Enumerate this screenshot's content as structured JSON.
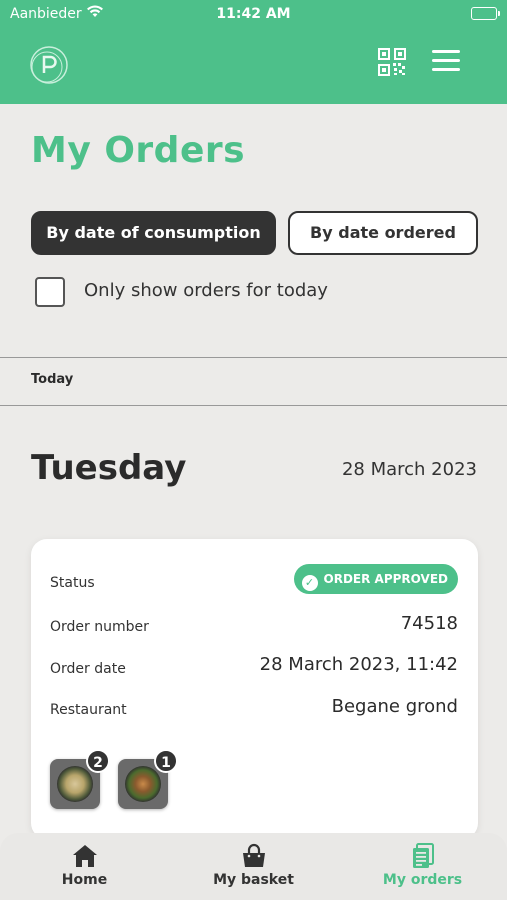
{
  "status_bar": {
    "carrier": "Aanbieder",
    "time": "11:42 AM"
  },
  "header": {
    "logo_icon": "p-logo-icon",
    "qr_icon": "qr-code-icon",
    "menu_icon": "hamburger-menu-icon"
  },
  "page": {
    "title": "My Orders"
  },
  "sort": {
    "by_consumption": "By date of consumption",
    "by_ordered": "By date ordered",
    "active": "by_consumption"
  },
  "filter": {
    "today_only_label": "Only show orders for today",
    "checked": false
  },
  "section": {
    "label": "Today"
  },
  "day": {
    "name": "Tuesday",
    "date": "28 March 2023"
  },
  "order": {
    "status_label": "Status",
    "status_value": "ORDER APPROVED",
    "number_label": "Order number",
    "number_value": "74518",
    "date_label": "Order date",
    "date_value": "28 March 2023, 11:42",
    "restaurant_label": "Restaurant",
    "restaurant_value": "Begane grond",
    "items": [
      {
        "count": "2"
      },
      {
        "count": "1"
      }
    ]
  },
  "tabs": [
    {
      "label": "Home",
      "icon": "home-icon",
      "active": false
    },
    {
      "label": "My basket",
      "icon": "basket-icon",
      "active": false
    },
    {
      "label": "My orders",
      "icon": "orders-icon",
      "active": true
    }
  ],
  "colors": {
    "brand": "#4dc08a",
    "dark": "#333333",
    "background": "#ecebe9"
  }
}
